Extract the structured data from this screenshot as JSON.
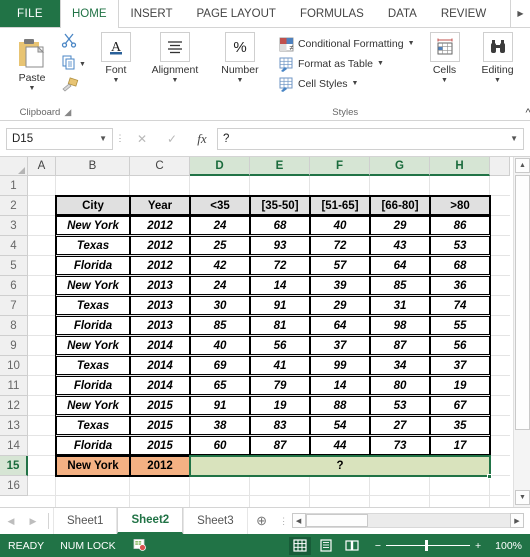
{
  "ribbon": {
    "file_tab": "FILE",
    "tabs": [
      "HOME",
      "INSERT",
      "PAGE LAYOUT",
      "FORMULAS",
      "DATA",
      "REVIEW"
    ],
    "active_tab": "HOME",
    "scroll_right_icon": "chevron-right-icon",
    "groups": {
      "clipboard": {
        "label": "Clipboard",
        "paste": "Paste",
        "cut_icon": "scissors-icon",
        "copy_icon": "copy-icon",
        "format_painter_icon": "format-painter-icon",
        "dialog_launcher_icon": "dialog-launcher-icon"
      },
      "font": {
        "label": "Font",
        "icon": "font-A-icon"
      },
      "alignment": {
        "label": "Alignment",
        "icon": "alignment-lines-icon"
      },
      "number": {
        "label": "Number",
        "icon": "percent-icon"
      },
      "styles": {
        "label": "Styles",
        "items": [
          {
            "label": "Conditional Formatting",
            "icon": "conditional-formatting-icon"
          },
          {
            "label": "Format as Table",
            "icon": "format-as-table-icon"
          },
          {
            "label": "Cell Styles",
            "icon": "cell-styles-icon"
          }
        ]
      },
      "cells": {
        "label": "Cells",
        "icon": "cells-table-icon"
      },
      "editing": {
        "label": "Editing",
        "icon": "binoculars-icon"
      },
      "collapse_icon": "chevron-up-icon"
    }
  },
  "formula_bar": {
    "name_box": "D15",
    "name_box_caret": "chevron-down-icon",
    "cancel_icon": "close-icon",
    "enter_icon": "check-icon",
    "function_icon": "fx",
    "formula_value": "?",
    "expand_caret": "chevron-down-icon"
  },
  "grid": {
    "columns": [
      "A",
      "B",
      "C",
      "D",
      "E",
      "F",
      "G",
      "H"
    ],
    "selected_columns": [
      "D",
      "E",
      "F",
      "G",
      "H"
    ],
    "rows": [
      1,
      2,
      3,
      4,
      5,
      6,
      7,
      8,
      9,
      10,
      11,
      12,
      13,
      14,
      15,
      16
    ],
    "selected_row": 15,
    "selection_range": "D15:H15",
    "accent_color": "#217346",
    "selection_fill": "#d9e3bd",
    "highlight_fill": "#f4b183",
    "header_fill": "#e0e0e0"
  },
  "table": {
    "headers": [
      "City",
      "Year",
      "<35",
      "[35-50]",
      "[51-65]",
      "[66-80]",
      ">80"
    ],
    "rows": [
      [
        "New York",
        "2012",
        "24",
        "68",
        "40",
        "29",
        "86"
      ],
      [
        "Texas",
        "2012",
        "25",
        "93",
        "72",
        "43",
        "53"
      ],
      [
        "Florida",
        "2012",
        "42",
        "72",
        "57",
        "64",
        "68"
      ],
      [
        "New York",
        "2013",
        "24",
        "14",
        "39",
        "85",
        "36"
      ],
      [
        "Texas",
        "2013",
        "30",
        "91",
        "29",
        "31",
        "74"
      ],
      [
        "Florida",
        "2013",
        "85",
        "81",
        "64",
        "98",
        "55"
      ],
      [
        "New York",
        "2014",
        "40",
        "56",
        "37",
        "87",
        "56"
      ],
      [
        "Texas",
        "2014",
        "69",
        "41",
        "99",
        "34",
        "37"
      ],
      [
        "Florida",
        "2014",
        "65",
        "79",
        "14",
        "80",
        "19"
      ],
      [
        "New York",
        "2015",
        "91",
        "19",
        "88",
        "53",
        "67"
      ],
      [
        "Texas",
        "2015",
        "38",
        "83",
        "54",
        "27",
        "35"
      ],
      [
        "Florida",
        "2015",
        "60",
        "87",
        "44",
        "73",
        "17"
      ]
    ],
    "query_row": {
      "city": "New York",
      "year": "2012",
      "result": "?"
    }
  },
  "sheet_bar": {
    "first_icon": "nav-first-icon",
    "prev_icon": "nav-prev-icon",
    "tabs": [
      "Sheet1",
      "Sheet2",
      "Sheet3"
    ],
    "active_tab": "Sheet2",
    "add_sheet_icon": "plus-circle-icon",
    "more_icon": "ellipsis-icon",
    "scroll_left_icon": "arrow-left-icon",
    "scroll_right_icon": "arrow-right-icon"
  },
  "status_bar": {
    "mode": "READY",
    "num_lock": "NUM LOCK",
    "macro_icon": "record-macro-icon",
    "views": [
      {
        "name": "normal-view",
        "icon": "grid-icon",
        "active": true
      },
      {
        "name": "page-layout-view",
        "icon": "page-icon",
        "active": false
      },
      {
        "name": "page-break-view",
        "icon": "book-icon",
        "active": false
      }
    ],
    "zoom_out": "−",
    "zoom_in": "+",
    "zoom_level": "100%"
  }
}
